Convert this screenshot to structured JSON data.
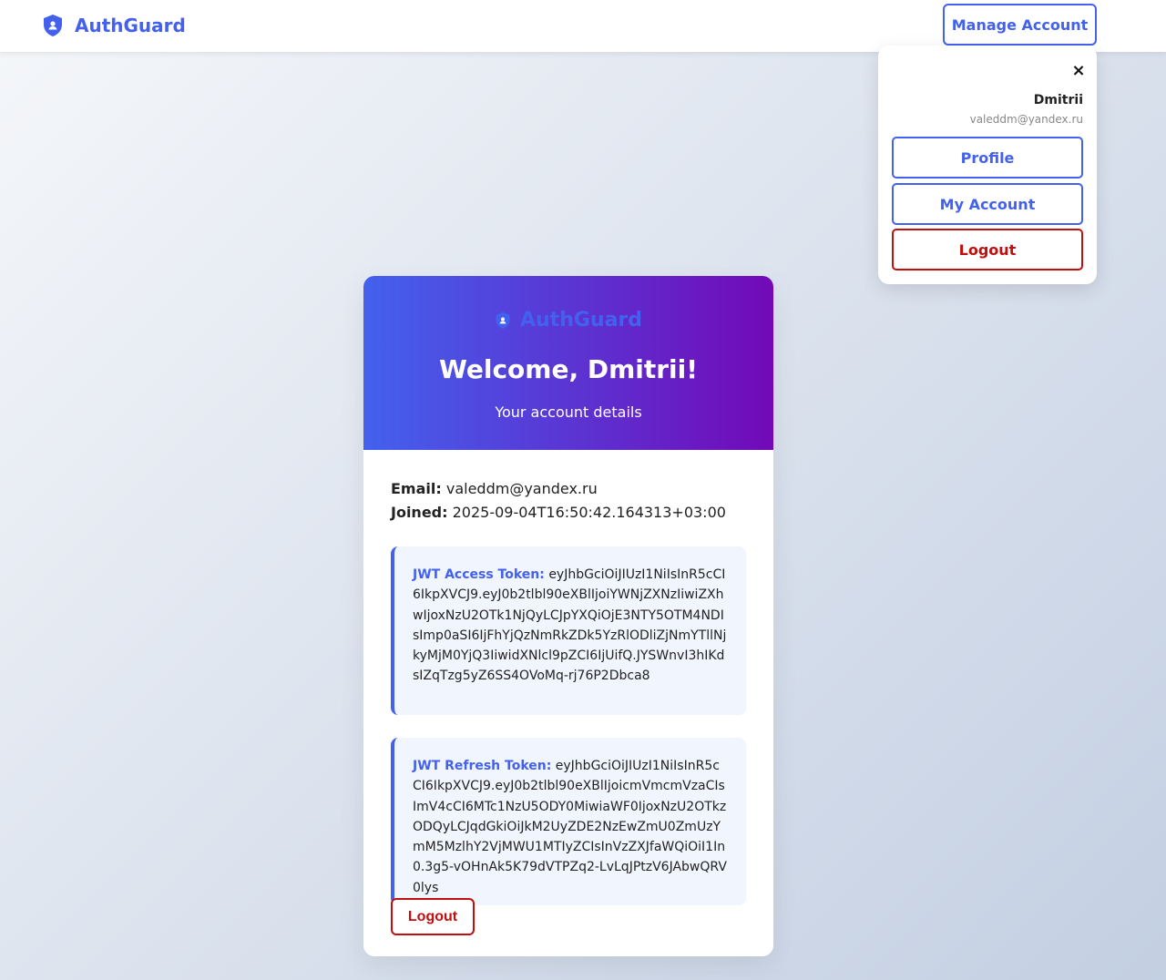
{
  "navbar": {
    "brand_name": "AuthGuard",
    "brand_icon": "shield-user-icon",
    "manage_account_label": "Manage Account"
  },
  "account_menu": {
    "close_label": "×",
    "user_name": "Dmitrii",
    "user_email": "valeddm@yandex.ru",
    "items": [
      {
        "label": "Profile"
      },
      {
        "label": "My Account"
      },
      {
        "label": "Logout"
      }
    ]
  },
  "card": {
    "brand_name": "AuthGuard",
    "title": "Welcome, Dmitrii!",
    "subtitle": "Your account details",
    "email_label": "Email:",
    "email_value": "valeddm@yandex.ru",
    "joined_label": "Joined:",
    "joined_value": "2025-09-04T16:50:42.164313+03:00",
    "access_token_label": "JWT Access Token:",
    "access_token_value": "eyJhbGciOiJIUzI1NiIsInR5cCI6IkpXVCJ9.eyJ0b2tlbl90eXBlIjoiYWNjZXNzIiwiZXhwIjoxNzU2OTk1NjQyLCJpYXQiOjE3NTY5OTM4NDIsImp0aSI6IjFhYjQzNmRkZDk5YzRlODliZjNmYTllNjkyMjM0YjQ3IiwidXNlcl9pZCI6IjUifQ.JYSWnvI3hIKdsIZqTzg5yZ6SS4OVoMq-rj76P2Dbca8",
    "refresh_token_label": "JWT Refresh Token:",
    "refresh_token_value": "eyJhbGciOiJIUzI1NiIsInR5cCI6IkpXVCJ9.eyJ0b2tlbl90eXBlIjoicmVmcmVzaCIsImV4cCI6MTc1NzU5ODY0MiwiaWF0IjoxNzU2OTkzODQyLCJqdGkiOiJkM2UyZDE2NzEwZmU0ZmUzYmM5MzlhY2VjMWU1MTIyZCIsInVzZXJfaWQiOiI1In0.3g5-vOHnAk5K79dVTPZq2-LvLqJPtzV6JAbwQRV0lys",
    "logout_label": "Logout"
  },
  "colors": {
    "primary": "#4361ee",
    "accent_purple": "#7209b7",
    "danger": "#c20e0e"
  }
}
